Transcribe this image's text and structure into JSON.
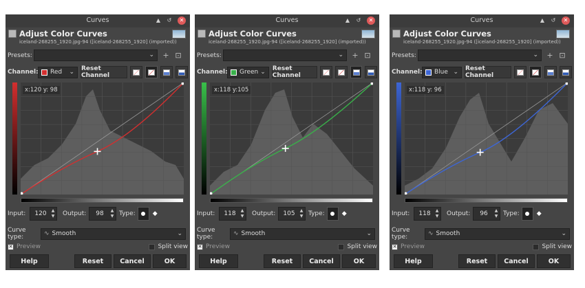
{
  "dialogs": [
    {
      "window_title": "Curves",
      "heading": "Adjust Color Curves",
      "subtitle": "iceland-268255_1920.jpg-94 ([iceland-268255_1920] (imported))",
      "presets_label": "Presets:",
      "presets_value": "",
      "channel_label": "Channel:",
      "channel_value": "Red",
      "reset_channel": "Reset Channel",
      "readout": "x:120 y: 98",
      "input_label": "Input:",
      "input_value": "120",
      "output_label": "Output:",
      "output_value": "98",
      "type_label": "Type:",
      "curve_type_label": "Curve type:",
      "curve_type_value": "Smooth",
      "preview_label": "Preview",
      "split_view_label": "Split view",
      "help": "Help",
      "reset": "Reset",
      "cancel": "Cancel",
      "ok": "OK",
      "channel_color": "#d32f2f",
      "channel_icon": "red-channel-swatch",
      "point_input": 120,
      "point_output": 98
    },
    {
      "window_title": "Curves",
      "heading": "Adjust Color Curves",
      "subtitle": "iceland-268255_1920.jpg-94 ([iceland-268255_1920] (imported))",
      "presets_label": "Presets:",
      "presets_value": "",
      "channel_label": "Channel:",
      "channel_value": "Green",
      "reset_channel": "Reset Channel",
      "readout": "x:118 y:105",
      "input_label": "Input:",
      "input_value": "118",
      "output_label": "Output:",
      "output_value": "105",
      "type_label": "Type:",
      "curve_type_label": "Curve type:",
      "curve_type_value": "Smooth",
      "preview_label": "Preview",
      "split_view_label": "Split view",
      "help": "Help",
      "reset": "Reset",
      "cancel": "Cancel",
      "ok": "OK",
      "channel_color": "#39b04a",
      "channel_icon": "green-channel-swatch",
      "point_input": 118,
      "point_output": 105
    },
    {
      "window_title": "Curves",
      "heading": "Adjust Color Curves",
      "subtitle": "iceland-268255_1920.jpg-94 ([iceland-268255_1920] (imported))",
      "presets_label": "Presets:",
      "presets_value": "",
      "channel_label": "Channel:",
      "channel_value": "Blue",
      "reset_channel": "Reset Channel",
      "readout": "x:118 y: 96",
      "input_label": "Input:",
      "input_value": "118",
      "output_label": "Output:",
      "output_value": "96",
      "type_label": "Type:",
      "curve_type_label": "Curve type:",
      "curve_type_value": "Smooth",
      "preview_label": "Preview",
      "split_view_label": "Split view",
      "help": "Help",
      "reset": "Reset",
      "cancel": "Cancel",
      "ok": "OK",
      "channel_color": "#3d66d6",
      "channel_icon": "blue-channel-swatch",
      "point_input": 118,
      "point_output": 96
    }
  ],
  "colors": {
    "window_bg": "#454545",
    "titlebar_bg": "#3c3c3c",
    "graph_bg": "#3a3a3a",
    "close_button": "#e05a5a"
  }
}
